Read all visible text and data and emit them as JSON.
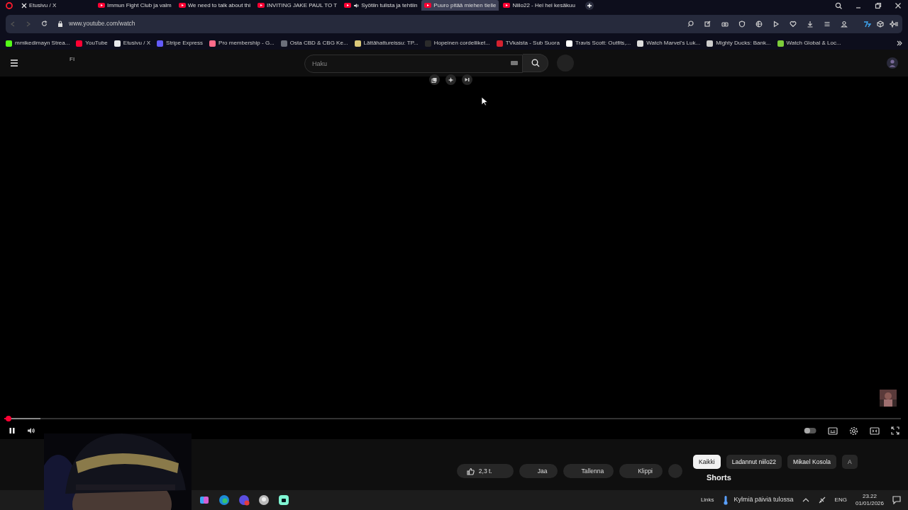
{
  "browser": {
    "tabs": [
      {
        "title": "Etusivu / X",
        "kind": "x",
        "selected": false,
        "audio": false
      },
      {
        "title": "Immun Fight Club ja valm",
        "kind": "youtube",
        "selected": false,
        "audio": false
      },
      {
        "title": "We need to talk about thi",
        "kind": "youtube",
        "selected": false,
        "audio": false
      },
      {
        "title": "INVITING JAKE PAUL TO T",
        "kind": "youtube",
        "selected": false,
        "audio": false
      },
      {
        "title": "Syötiin tulista ja tehtiin",
        "kind": "youtube",
        "selected": false,
        "audio": true
      },
      {
        "title": "Puuro pitää miehen tielle",
        "kind": "youtube",
        "selected": true,
        "audio": false
      },
      {
        "title": "Niilo22 - Hei hei kesäkuu",
        "kind": "youtube",
        "selected": false,
        "audio": false
      }
    ],
    "url": "www.youtube.com/watch",
    "bookmarks": [
      {
        "label": "mmikedimayn Strea...",
        "color": "#53fc18"
      },
      {
        "label": "YouTube",
        "color": "#ff0033"
      },
      {
        "label": "Etusivu / X",
        "color": "#e7e9ea"
      },
      {
        "label": "Stripe Express",
        "color": "#635bff"
      },
      {
        "label": "Pro membership - G...",
        "color": "#ff6b8b"
      },
      {
        "label": "Osta CBD & CBG Ke...",
        "color": "#6b6f7a"
      },
      {
        "label": "Lättähattureissu: TP...",
        "color": "#d9c77a"
      },
      {
        "label": "Hopeinen cordelliket...",
        "color": "#2b2b2b"
      },
      {
        "label": "TVkaista - Sub Suora",
        "color": "#d4212f"
      },
      {
        "label": "Travis Scott: Outfits,...",
        "color": "#ffffff"
      },
      {
        "label": "Watch Marvel's Luk...",
        "color": "#dddddd"
      },
      {
        "label": "Mighty Ducks: Bank...",
        "color": "#cccccc"
      },
      {
        "label": "Watch Global & Loc...",
        "color": "#7ccc3a"
      }
    ]
  },
  "youtube": {
    "region": "FI",
    "search": {
      "placeholder": "Haku"
    },
    "player": {
      "playing": true,
      "progress": {
        "level": 0.005
      },
      "buffer": {
        "level": 0.04
      }
    },
    "likes": "2,3 t.",
    "buttons": [
      "Jaa",
      "Tallenna",
      "Klippi"
    ],
    "chips": [
      {
        "label": "Kaikki",
        "selected": true
      },
      {
        "label": "Ladannut niilo22",
        "selected": false
      },
      {
        "label": "Mikael Kosola",
        "selected": false
      },
      {
        "label": "A",
        "selected": false
      }
    ],
    "section": "Shorts"
  },
  "taskbar": {
    "links": "Links",
    "weather": "Kylmiä päiviä tulossa",
    "language": "ENG",
    "time": "23.22",
    "date": "01/01/2026"
  }
}
